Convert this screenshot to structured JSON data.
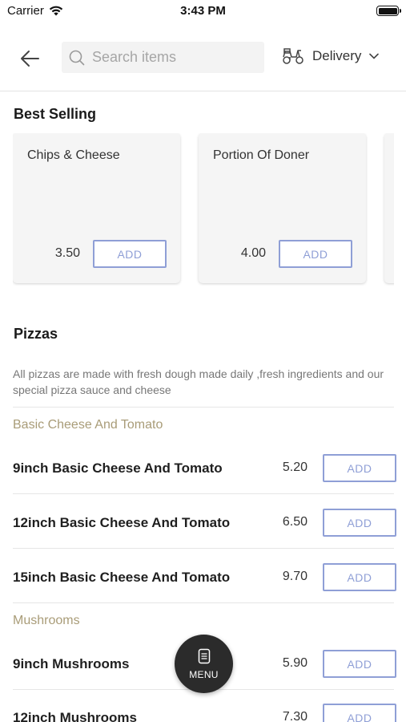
{
  "status_bar": {
    "carrier": "Carrier",
    "time": "3:43 PM"
  },
  "header": {
    "search_placeholder": "Search items",
    "delivery_label": "Delivery"
  },
  "best_selling": {
    "title": "Best Selling",
    "items": [
      {
        "name": "Chips & Cheese",
        "price": "3.50",
        "add_label": "ADD"
      },
      {
        "name": "Portion Of Doner",
        "price": "4.00",
        "add_label": "ADD"
      }
    ]
  },
  "pizzas": {
    "title": "Pizzas",
    "description": "All pizzas are made with fresh dough made daily ,fresh ingredients and our special pizza sauce and cheese",
    "subcategories": [
      {
        "name": "Basic Cheese And Tomato",
        "items": [
          {
            "name": "9inch Basic Cheese And Tomato",
            "price": "5.20",
            "add_label": "ADD"
          },
          {
            "name": "12inch Basic Cheese And Tomato",
            "price": "6.50",
            "add_label": "ADD"
          },
          {
            "name": "15inch Basic Cheese And Tomato",
            "price": "9.70",
            "add_label": "ADD"
          }
        ]
      },
      {
        "name": "Mushrooms",
        "items": [
          {
            "name": "9inch Mushrooms",
            "price": "5.90",
            "add_label": "ADD"
          },
          {
            "name": "12inch Mushrooms",
            "price": "7.30",
            "add_label": "ADD"
          }
        ]
      }
    ]
  },
  "menu_fab": {
    "label": "MENU"
  },
  "colors": {
    "accent": "#8f9fd6",
    "subcategory": "#a99c78",
    "fab": "#2b2b2b"
  }
}
